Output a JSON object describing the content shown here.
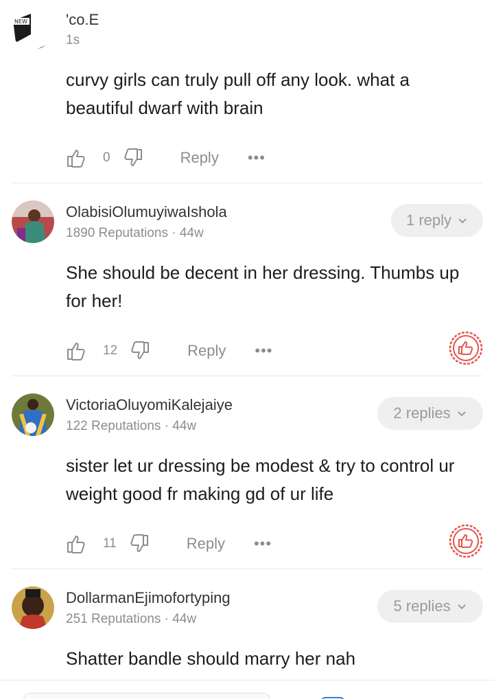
{
  "comments": [
    {
      "username": "ʹco.E",
      "meta": "1s",
      "body": "curvy girls can truly pull off any look. what a beautiful dwarf with brain",
      "likes": "0",
      "reply_label": "Reply",
      "more_label": "•••"
    },
    {
      "username": "OlabisiOlumuyiwaIshola",
      "meta": "1890 Reputations · 44w",
      "body": "She should be decent in her dressing. Thumbs up for her!",
      "likes": "12",
      "reply_label": "Reply",
      "more_label": "•••",
      "replies_label": "1 reply"
    },
    {
      "username": "VictoriaOluyomiKalejaiye",
      "meta": "122 Reputations · 44w",
      "body": "sister let ur dressing be modest & try to control ur weight good fr making gd of ur life",
      "likes": "11",
      "reply_label": "Reply",
      "more_label": "•••",
      "replies_label": "2 replies"
    },
    {
      "username": "DollarmanEjimofortyping",
      "meta": "251 Reputations · 44w",
      "body": "Shatter bandle should marry her nah",
      "replies_label": "5 replies"
    }
  ],
  "colors": {
    "hot_badge": "#e5534b",
    "pill_bg": "#efefef",
    "muted_text": "#8c8c8c"
  },
  "icons": {
    "like": "thumbs-up-outline-icon",
    "dislike": "thumbs-down-outline-icon",
    "more": "more-dots-icon",
    "hot": "hot-comment-thumb-badge-icon",
    "pill": "chevron-down-icon"
  }
}
